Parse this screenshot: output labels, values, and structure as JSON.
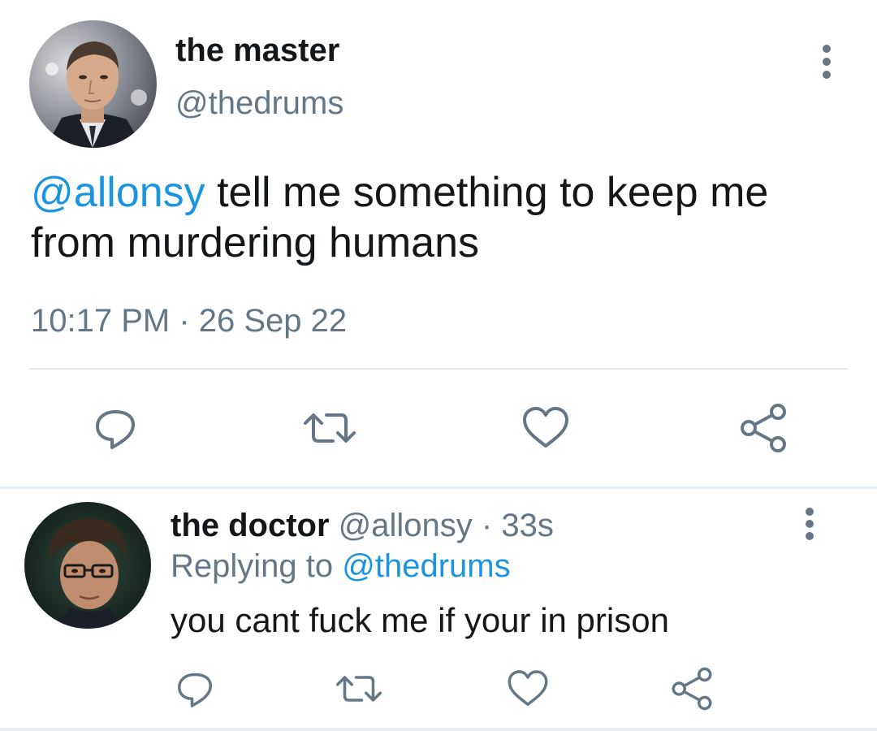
{
  "main_tweet": {
    "display_name": "the master",
    "handle": "@thedrums",
    "text_mention": "@allonsy",
    "text_body": " tell me something to keep me from murdering humans",
    "timestamp": "10:17 PM · 26 Sep 22",
    "avatar_icon": "avatar-man-in-suit",
    "actions": [
      "reply-icon",
      "retweet-icon",
      "like-icon",
      "share-icon"
    ]
  },
  "reply_tweet": {
    "display_name": "the doctor",
    "meta": " @allonsy · 33s",
    "replying_prefix": "Replying to ",
    "replying_handle": "@thedrums",
    "text": "you cant fuck me if your in prison",
    "avatar_icon": "avatar-man-with-glasses",
    "actions": [
      "reply-icon",
      "retweet-icon",
      "like-icon",
      "share-icon"
    ]
  },
  "colors": {
    "link": "#1b95e0",
    "secondary_text": "#657786",
    "primary_text": "#14171a",
    "icon": "#657786",
    "divider": "#e1e8ed"
  }
}
